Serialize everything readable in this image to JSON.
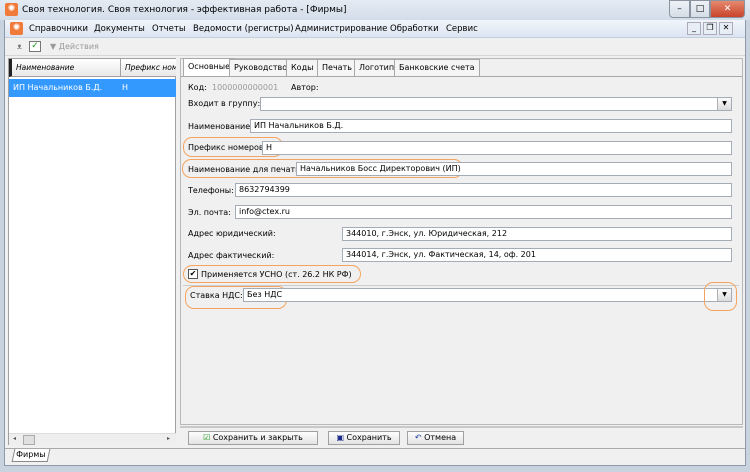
{
  "window": {
    "title": "Своя технология. Своя технология - эффективная работа - [Фирмы]"
  },
  "menu": [
    "Справочники",
    "Документы",
    "Отчеты",
    "Ведомости (регистры)",
    "Администрирование",
    "Обработки",
    "Сервис"
  ],
  "toolbar": {
    "actions_label": "Действия"
  },
  "list": {
    "columns": [
      "Наименование",
      "Префикс номе"
    ],
    "rows": [
      {
        "name": "ИП Начальников Б.Д.",
        "prefix": "Н"
      }
    ]
  },
  "tabs": [
    "Основные",
    "Руководство",
    "Коды",
    "Печать",
    "Логотип",
    "Банковские счета"
  ],
  "form": {
    "code_label": "Код:",
    "code_value": "1000000000001",
    "author_label": "Автор:",
    "group_label": "Входит в группу:",
    "group_value": "",
    "name_label": "Наименование:",
    "name_value": "ИП Начальников Б.Д.",
    "prefix_label": "Префикс номеров:",
    "prefix_value": "Н",
    "print_name_label": "Наименование для печати:",
    "print_name_value": "Начальников Босс Директорович (ИП)",
    "phones_label": "Телефоны:",
    "phones_value": "8632794399",
    "email_label": "Эл. почта:",
    "email_value": "info@ctex.ru",
    "legal_address_label": "Адрес юридический:",
    "legal_address_value": "344010, г.Энск, ул. Юридическая, 212",
    "actual_address_label": "Адрес фактический:",
    "actual_address_value": "344014, г.Энск, ул. Фактическая, 14, оф. 201",
    "usno_label": "Применяется УСНО (ст. 26.2 НК РФ)",
    "usno_checked": true,
    "vat_label": "Ставка НДС:",
    "vat_value": "Без НДС"
  },
  "buttons": {
    "save_close": "Сохранить и закрыть",
    "save": "Сохранить",
    "cancel": "Отмена"
  },
  "bottom_tab": "Фирмы",
  "colors": {
    "selection": "#3399ff",
    "highlight": "#f4a460",
    "close": "#d9553a"
  }
}
